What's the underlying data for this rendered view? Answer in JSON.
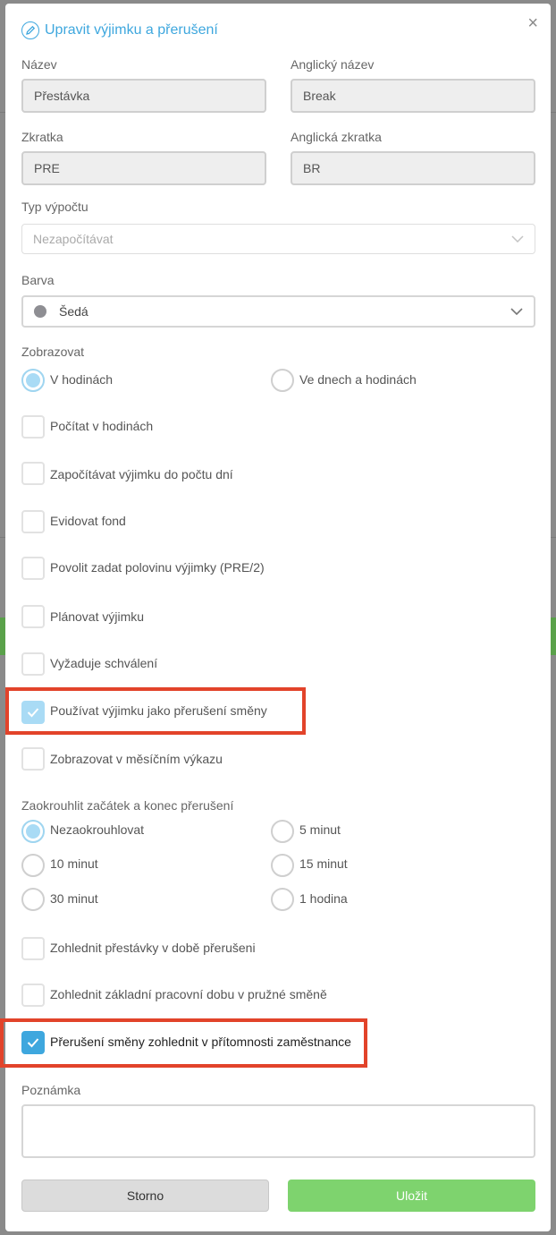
{
  "modal": {
    "title": "Upravit výjimku a přerušení",
    "close_label": "×"
  },
  "fields": {
    "name_label": "Název",
    "name_value": "Přestávka",
    "en_name_label": "Anglický název",
    "en_name_value": "Break",
    "abbr_label": "Zkratka",
    "abbr_value": "PRE",
    "en_abbr_label": "Anglická zkratka",
    "en_abbr_value": "BR",
    "calc_type_label": "Typ výpočtu",
    "calc_type_value": "Nezapočítávat",
    "color_label": "Barva",
    "color_value": "Šedá",
    "color_swatch": "#8e8e93"
  },
  "display": {
    "label": "Zobrazovat",
    "options": [
      {
        "label": "V hodinách",
        "selected": true
      },
      {
        "label": "Ve dnech a hodinách",
        "selected": false
      }
    ]
  },
  "checkboxes_a": [
    {
      "label": "Počítat v hodinách",
      "checked": false
    },
    {
      "label": "Započítávat výjimku do počtu dní",
      "checked": false
    },
    {
      "label": "Evidovat fond",
      "checked": false
    },
    {
      "label": "Povolit zadat polovinu výjimky (PRE/2)",
      "checked": false
    },
    {
      "label": "Plánovat výjimku",
      "checked": false
    },
    {
      "label": "Vyžaduje schválení",
      "checked": false
    },
    {
      "label": "Používat výjimku jako přerušení směny",
      "checked": true
    },
    {
      "label": "Zobrazovat v měsíčním výkazu",
      "checked": false
    }
  ],
  "rounding": {
    "label": "Zaokrouhlit začátek a konec přerušení",
    "options": [
      {
        "label": "Nezaokrouhlovat",
        "selected": true
      },
      {
        "label": "5 minut",
        "selected": false
      },
      {
        "label": "10 minut",
        "selected": false
      },
      {
        "label": "15 minut",
        "selected": false
      },
      {
        "label": "30 minut",
        "selected": false
      },
      {
        "label": "1 hodina",
        "selected": false
      }
    ]
  },
  "checkboxes_b": [
    {
      "label": "Zohlednit přestávky v době přerušeni",
      "checked": false
    },
    {
      "label": "Zohlednit základní pracovní dobu v pružné směně",
      "checked": false
    },
    {
      "label": "Přerušení směny zohlednit v přítomnosti zaměstnance",
      "checked": true
    }
  ],
  "note": {
    "label": "Poznámka",
    "value": ""
  },
  "buttons": {
    "cancel": "Storno",
    "save": "Uložit"
  },
  "colors": {
    "accent": "#3ea7de",
    "highlight": "#e2432a",
    "save": "#7ed36e"
  }
}
